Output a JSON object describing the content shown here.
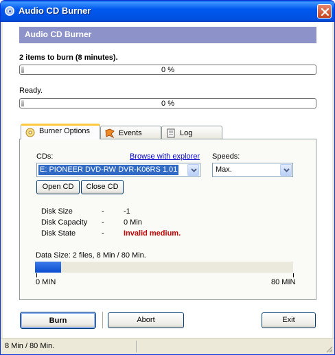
{
  "window": {
    "title": "Audio CD Burner"
  },
  "header": {
    "title": "Audio CD Burner"
  },
  "progress1": {
    "label": "2 items to burn (8 minutes).",
    "percent_text": "0 %",
    "value": 0
  },
  "progress2": {
    "label": "Ready.",
    "percent_text": "0 %",
    "value": 0
  },
  "tabs": [
    {
      "label": "Burner Options",
      "icon": "cd-icon",
      "active": true
    },
    {
      "label": "Events",
      "icon": "events-icon",
      "active": false
    },
    {
      "label": "Log",
      "icon": "log-icon",
      "active": false
    }
  ],
  "burner_options": {
    "cds_label": "CDs:",
    "browse_link": "Browse with explorer",
    "cd_selected": "E: PIONEER  DVD-RW DVR-K06RS 1.01",
    "speeds_label": "Speeds:",
    "speed_selected": "Max.",
    "open_cd": "Open CD",
    "close_cd": "Close CD",
    "disk_info": [
      {
        "key": "Disk Size",
        "sep": "-",
        "value": "-1"
      },
      {
        "key": "Disk Capacity",
        "sep": "-",
        "value": "0 Min"
      },
      {
        "key": "Disk State",
        "sep": "-",
        "value": "Invalid medium."
      }
    ],
    "data_size_label": "Data Size: 2 files, 8 Min / 80 Min.",
    "data_size_fraction": 0.1,
    "scale_min": "0 MIN",
    "scale_max": "80 MIN"
  },
  "buttons": {
    "burn": "Burn",
    "abort": "Abort",
    "exit": "Exit"
  },
  "status": {
    "text": "8 Min / 80 Min."
  },
  "colors": {
    "title_bar": "#0054e3",
    "header_band": "#8d92c9",
    "tab_accent": "#ffc83c",
    "error": "#c00000",
    "data_fill": "#0b4dd0"
  }
}
